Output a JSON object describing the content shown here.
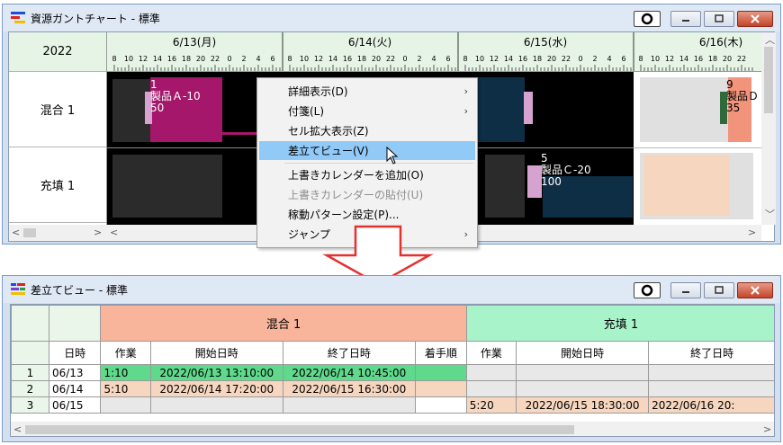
{
  "gantt_window": {
    "title": "資源ガントチャート - 標準",
    "year": "2022",
    "dates": [
      "6/13(月)",
      "6/14(火)",
      "6/15(水)",
      "6/16(木)"
    ],
    "hour_ticks": [
      "8",
      "10",
      "12",
      "14",
      "16",
      "18",
      "20",
      "22",
      "0",
      "2",
      "4",
      "6"
    ],
    "last_hour_ticks": [
      "8",
      "10",
      "12",
      "14",
      "16",
      "18",
      "20",
      "22"
    ],
    "resources": [
      {
        "name": "混合 1",
        "color": "#f8b59b"
      },
      {
        "name": "充填 1",
        "color": "#a9f3cb"
      }
    ],
    "bars": [
      {
        "text": "1\n製品Ａ-10\n50"
      },
      {
        "text": "5\n製品Ｃ-20\n100"
      },
      {
        "text": "9\n製品Ｄ\n35"
      }
    ]
  },
  "context_menu": {
    "items": [
      {
        "label": "詳細表示(D)",
        "submenu": true,
        "disabled": false,
        "selected": false
      },
      {
        "label": "付箋(L)",
        "submenu": true,
        "disabled": false,
        "selected": false
      },
      {
        "label": "セル拡大表示(Z)",
        "submenu": false,
        "disabled": false,
        "selected": false
      },
      {
        "label": "差立てビュー(V)",
        "submenu": false,
        "disabled": false,
        "selected": true
      },
      {
        "label": "上書きカレンダーを追加(O)",
        "submenu": false,
        "disabled": false,
        "selected": false
      },
      {
        "label": "上書きカレンダーの貼付(U)",
        "submenu": false,
        "disabled": true,
        "selected": false
      },
      {
        "label": "稼動パターン設定(P)...",
        "submenu": false,
        "disabled": false,
        "selected": false
      },
      {
        "label": "ジャンプ",
        "submenu": true,
        "disabled": false,
        "selected": false
      }
    ]
  },
  "dispatch_window": {
    "title": "差立てビュー - 標準",
    "groups": [
      "混合 1",
      "充填 1"
    ],
    "columns": {
      "date": "日時",
      "job": "作業",
      "start": "開始日時",
      "end": "終了日時",
      "order": "着手順"
    },
    "rows": [
      {
        "no": "1",
        "date": "06/13",
        "m_job": "1:10",
        "m_start": "2022/06/13 13:10:00",
        "m_end": "2022/06/14 10:45:00",
        "m_order": "",
        "f_job": "",
        "f_start": "",
        "f_end": ""
      },
      {
        "no": "2",
        "date": "06/14",
        "m_job": "5:10",
        "m_start": "2022/06/14 17:20:00",
        "m_end": "2022/06/15 16:30:00",
        "m_order": "",
        "f_job": "",
        "f_start": "",
        "f_end": ""
      },
      {
        "no": "3",
        "date": "06/15",
        "m_job": "",
        "m_start": "",
        "m_end": "",
        "m_order": "",
        "f_job": "5:20",
        "f_start": "2022/06/15 18:30:00",
        "f_end": "2022/06/16 20:"
      }
    ]
  },
  "colors": {
    "mix": "#f8b59b",
    "fill": "#a9f3cb",
    "green_row": "#5fd98c",
    "peach_row": "#f6d6bf",
    "header_bg": "#eaf6ea"
  }
}
